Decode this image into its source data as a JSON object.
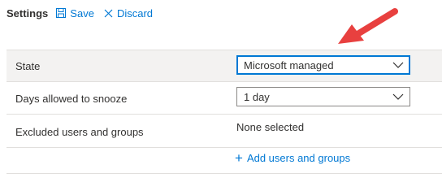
{
  "toolbar": {
    "title": "Settings",
    "save_label": "Save",
    "discard_label": "Discard",
    "save_icon": "save-icon",
    "discard_icon": "close-icon"
  },
  "rows": [
    {
      "label": "State",
      "value": "Microsoft managed"
    },
    {
      "label": "Days allowed to snooze",
      "value": "1 day"
    },
    {
      "label": "Excluded users and groups",
      "value": "None selected"
    }
  ],
  "add_link": {
    "label": "Add users and groups",
    "icon": "plus-icon"
  },
  "colors": {
    "accent": "#0078d4",
    "highlight_row": "#f3f2f1",
    "annotation_arrow": "#e8403f"
  }
}
